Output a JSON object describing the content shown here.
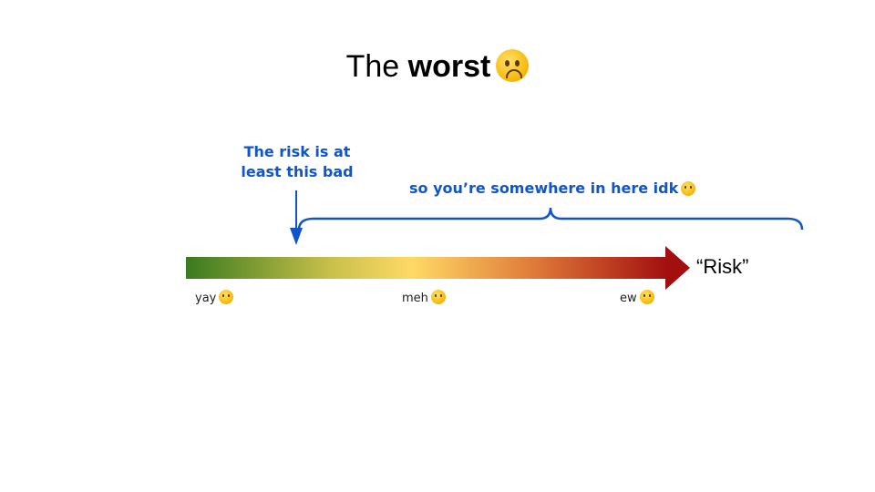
{
  "slide": {
    "title_plain": "The",
    "title_bold": "worst",
    "title_emoji": "worried-face-icon"
  },
  "annotations": {
    "at_least_part1": "The risk is ",
    "at_least_bold1": "at",
    "at_least_bold2": "least",
    "at_least_part2": " this bad",
    "somewhere": "so you’re somewhere in here idk",
    "somewhere_emoji": "raised-eyebrow-face-icon"
  },
  "scale": {
    "axis_label": "“Risk”",
    "ticks": [
      {
        "label": "yay",
        "emoji": "smiling-face-icon"
      },
      {
        "label": "meh",
        "emoji": "neutral-face-icon"
      },
      {
        "label": "ew",
        "emoji": "grimacing-face-icon"
      }
    ],
    "gradient_colors": [
      "#3a7a1e",
      "#c8c04a",
      "#ffd966",
      "#e07b3a",
      "#a30f0f"
    ]
  },
  "colors": {
    "annotation_blue": "#1155cc"
  }
}
